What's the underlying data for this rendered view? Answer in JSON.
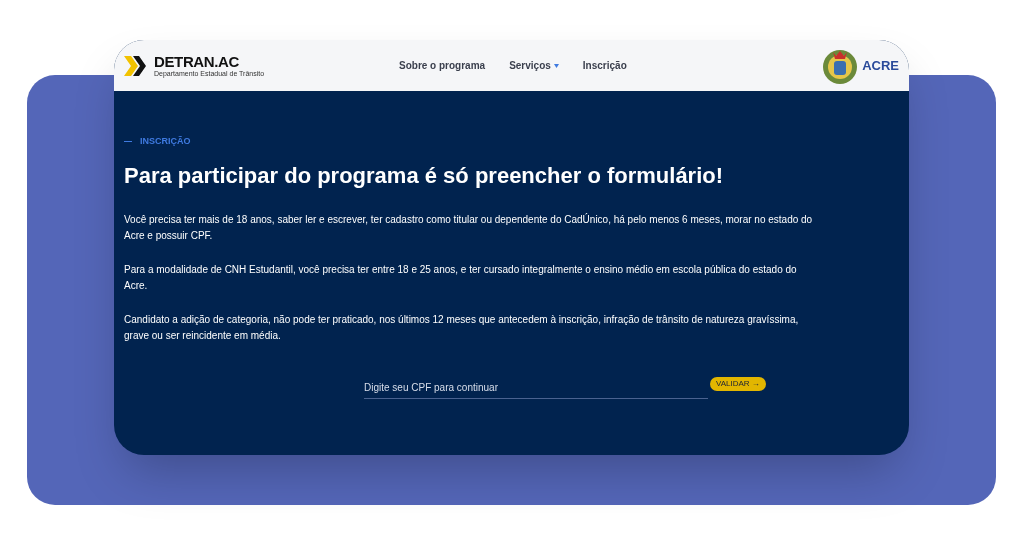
{
  "header": {
    "logo": {
      "name": "DETRAN.AC",
      "subtitle": "Departamento Estadual de Trânsito"
    },
    "nav": [
      {
        "label": "Sobre o programa",
        "dropdown": false
      },
      {
        "label": "Serviços",
        "dropdown": true
      },
      {
        "label": "Inscrição",
        "dropdown": false
      }
    ],
    "state_logo": {
      "name": "ACRE"
    }
  },
  "section": {
    "eyebrow": "INSCRIÇÃO",
    "title": "Para participar do programa é só preencher o formulário!",
    "paragraphs": [
      "Você precisa ter mais de 18 anos, saber ler e escrever, ter cadastro como titular ou dependente do CadÚnico, há pelo menos 6 meses, morar no estado do Acre e possuir CPF.",
      "Para a modalidade de CNH Estudantil, você precisa ter entre 18 e 25 anos, e ter cursado integralmente o ensino médio em escola pública do estado do Acre.",
      "Candidato a adição de categoria, não pode ter praticado, nos últimos 12 meses que antecedem à inscrição, infração de trânsito de natureza gravíssima, grave ou ser reincidente em média."
    ],
    "cpf_field": {
      "placeholder": "Digite seu CPF para continuar"
    },
    "button": "VALIDAR →"
  }
}
